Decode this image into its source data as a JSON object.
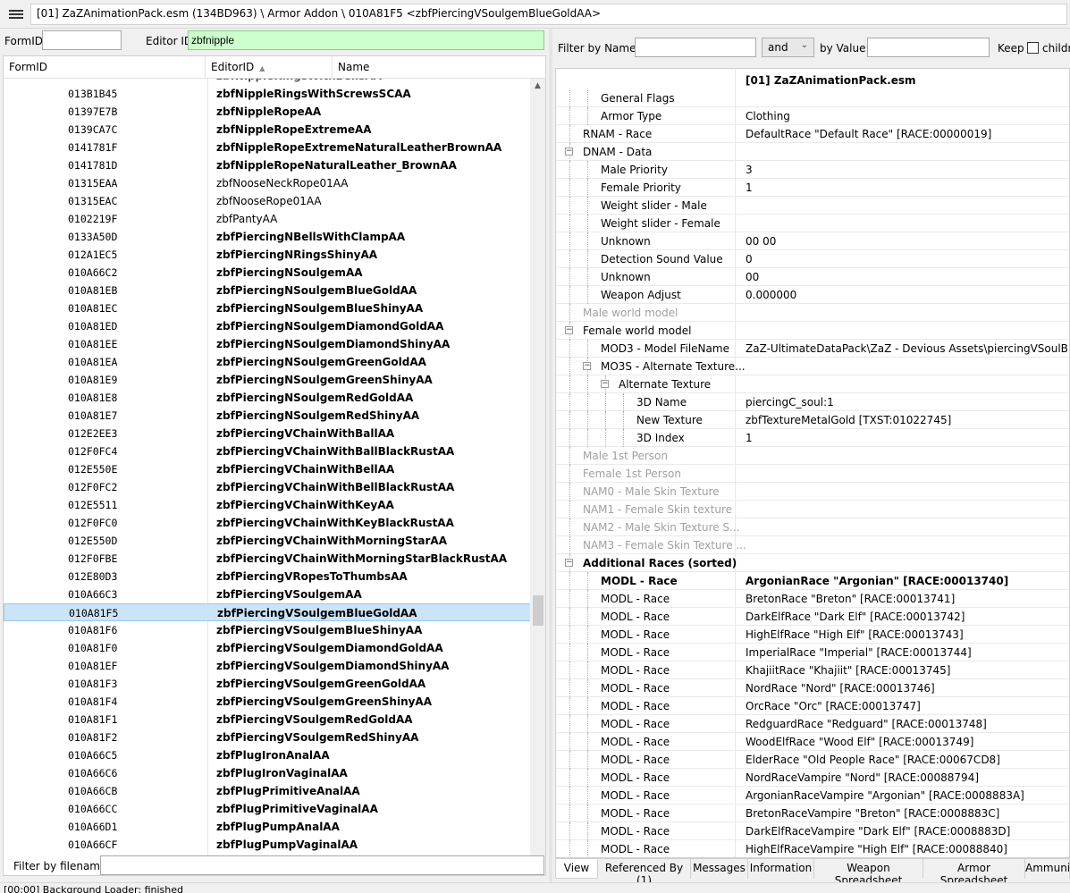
{
  "header": {
    "path": "[01] ZaZAnimationPack.esm (134BD963) \\ Armor Addon \\ 010A81F5 <zbfPiercingVSoulgemBlueGoldAA>"
  },
  "left": {
    "formid_label": "FormID",
    "formid_value": "",
    "editorid_label": "Editor ID",
    "editorid_value": "zbfnipple",
    "columns": [
      "FormID",
      "EditorID",
      "Name"
    ],
    "rows": [
      {
        "fid": "013B1B45",
        "eid": "zbfNippleRingsWithScrewsSCAA",
        "mod": true
      },
      {
        "fid": "01397E7B",
        "eid": "zbfNippleRopeAA",
        "mod": true
      },
      {
        "fid": "0139CA7C",
        "eid": "zbfNippleRopeExtremeAA",
        "mod": true
      },
      {
        "fid": "0141781F",
        "eid": "zbfNippleRopeExtremeNaturalLeatherBrownAA",
        "mod": true
      },
      {
        "fid": "0141781D",
        "eid": "zbfNippleRopeNaturalLeather_BrownAA",
        "mod": true
      },
      {
        "fid": "01315EAA",
        "eid": "zbfNooseNeckRope01AA",
        "mod": false
      },
      {
        "fid": "01315EAC",
        "eid": "zbfNooseRope01AA",
        "mod": false
      },
      {
        "fid": "0102219F",
        "eid": "zbfPantyAA",
        "mod": false
      },
      {
        "fid": "0133A50D",
        "eid": "zbfPiercingNBellsWithClampAA",
        "mod": true
      },
      {
        "fid": "012A1EC5",
        "eid": "zbfPiercingNRingsShinyAA",
        "mod": true
      },
      {
        "fid": "010A66C2",
        "eid": "zbfPiercingNSoulgemAA",
        "mod": true
      },
      {
        "fid": "010A81EB",
        "eid": "zbfPiercingNSoulgemBlueGoldAA",
        "mod": true
      },
      {
        "fid": "010A81EC",
        "eid": "zbfPiercingNSoulgemBlueShinyAA",
        "mod": true
      },
      {
        "fid": "010A81ED",
        "eid": "zbfPiercingNSoulgemDiamondGoldAA",
        "mod": true
      },
      {
        "fid": "010A81EE",
        "eid": "zbfPiercingNSoulgemDiamondShinyAA",
        "mod": true
      },
      {
        "fid": "010A81EA",
        "eid": "zbfPiercingNSoulgemGreenGoldAA",
        "mod": true
      },
      {
        "fid": "010A81E9",
        "eid": "zbfPiercingNSoulgemGreenShinyAA",
        "mod": true
      },
      {
        "fid": "010A81E8",
        "eid": "zbfPiercingNSoulgemRedGoldAA",
        "mod": true
      },
      {
        "fid": "010A81E7",
        "eid": "zbfPiercingNSoulgemRedShinyAA",
        "mod": true
      },
      {
        "fid": "012E2EE3",
        "eid": "zbfPiercingVChainWithBallAA",
        "mod": true
      },
      {
        "fid": "012F0FC4",
        "eid": "zbfPiercingVChainWithBallBlackRustAA",
        "mod": true
      },
      {
        "fid": "012E550E",
        "eid": "zbfPiercingVChainWithBellAA",
        "mod": true
      },
      {
        "fid": "012F0FC2",
        "eid": "zbfPiercingVChainWithBellBlackRustAA",
        "mod": true
      },
      {
        "fid": "012E5511",
        "eid": "zbfPiercingVChainWithKeyAA",
        "mod": true
      },
      {
        "fid": "012F0FC0",
        "eid": "zbfPiercingVChainWithKeyBlackRustAA",
        "mod": true
      },
      {
        "fid": "012E550D",
        "eid": "zbfPiercingVChainWithMorningStarAA",
        "mod": true
      },
      {
        "fid": "012F0FBE",
        "eid": "zbfPiercingVChainWithMorningStarBlackRustAA",
        "mod": true
      },
      {
        "fid": "012E80D3",
        "eid": "zbfPiercingVRopesToThumbsAA",
        "mod": true
      },
      {
        "fid": "010A66C3",
        "eid": "zbfPiercingVSoulgemAA",
        "mod": true
      },
      {
        "fid": "010A81F5",
        "eid": "zbfPiercingVSoulgemBlueGoldAA",
        "mod": true,
        "sel": true
      },
      {
        "fid": "010A81F6",
        "eid": "zbfPiercingVSoulgemBlueShinyAA",
        "mod": true
      },
      {
        "fid": "010A81F0",
        "eid": "zbfPiercingVSoulgemDiamondGoldAA",
        "mod": true
      },
      {
        "fid": "010A81EF",
        "eid": "zbfPiercingVSoulgemDiamondShinyAA",
        "mod": true
      },
      {
        "fid": "010A81F3",
        "eid": "zbfPiercingVSoulgemGreenGoldAA",
        "mod": true
      },
      {
        "fid": "010A81F4",
        "eid": "zbfPiercingVSoulgemGreenShinyAA",
        "mod": true
      },
      {
        "fid": "010A81F1",
        "eid": "zbfPiercingVSoulgemRedGoldAA",
        "mod": true
      },
      {
        "fid": "010A81F2",
        "eid": "zbfPiercingVSoulgemRedShinyAA",
        "mod": true
      },
      {
        "fid": "010A66C5",
        "eid": "zbfPlugIronAnalAA",
        "mod": true
      },
      {
        "fid": "010A66C6",
        "eid": "zbfPlugIronVaginalAA",
        "mod": true
      },
      {
        "fid": "010A66CB",
        "eid": "zbfPlugPrimitiveAnalAA",
        "mod": true
      },
      {
        "fid": "010A66CC",
        "eid": "zbfPlugPrimitiveVaginalAA",
        "mod": true
      },
      {
        "fid": "010A66D1",
        "eid": "zbfPlugPumpAnalAA",
        "mod": true
      },
      {
        "fid": "010A66CF",
        "eid": "zbfPlugPumpVaginalAA",
        "mod": true
      }
    ],
    "filter_label": "Filter by filename:",
    "filter_value": ""
  },
  "right": {
    "filter_name_label": "Filter by Name:",
    "and_value": "and",
    "by_value_label": "by Value:",
    "keep_label": "Keep",
    "children_label": "children",
    "column_header": "[01] ZaZAnimationPack.esm",
    "tree": [
      {
        "n": "General Flags",
        "v": "",
        "lvl": 2
      },
      {
        "n": "Armor Type",
        "v": "Clothing",
        "lvl": 2
      },
      {
        "n": "RNAM - Race",
        "v": "DefaultRace \"Default Race\" [RACE:00000019]",
        "lvl": 1
      },
      {
        "n": "DNAM - Data",
        "v": "",
        "lvl": 1,
        "exp": "−"
      },
      {
        "n": "Male Priority",
        "v": "3",
        "lvl": 2
      },
      {
        "n": "Female Priority",
        "v": "1",
        "lvl": 2
      },
      {
        "n": "Weight slider - Male",
        "v": "",
        "lvl": 2
      },
      {
        "n": "Weight slider - Female",
        "v": "",
        "lvl": 2
      },
      {
        "n": "Unknown",
        "v": "00 00",
        "lvl": 2
      },
      {
        "n": "Detection Sound Value",
        "v": "0",
        "lvl": 2
      },
      {
        "n": "Unknown",
        "v": "00",
        "lvl": 2
      },
      {
        "n": "Weapon Adjust",
        "v": "0.000000",
        "lvl": 2
      },
      {
        "n": "Male world model",
        "v": "",
        "lvl": 1,
        "dis": true
      },
      {
        "n": "Female world model",
        "v": "",
        "lvl": 1,
        "exp": "−"
      },
      {
        "n": "MOD3 - Model FileName",
        "v": "ZaZ-UltimateDataPack\\ZaZ - Devious Assets\\piercingVSoulBlue.nif",
        "lvl": 2
      },
      {
        "n": "MO3S - Alternate Texture...",
        "v": "",
        "lvl": 2,
        "exp": "−"
      },
      {
        "n": "Alternate Texture",
        "v": "",
        "lvl": 3,
        "exp": "−"
      },
      {
        "n": "3D Name",
        "v": "piercingC_soul:1",
        "lvl": 4
      },
      {
        "n": "New Texture",
        "v": "zbfTextureMetalGold [TXST:01022745]",
        "lvl": 4
      },
      {
        "n": "3D Index",
        "v": "1",
        "lvl": 4
      },
      {
        "n": "Male 1st Person",
        "v": "",
        "lvl": 1,
        "dis": true
      },
      {
        "n": "Female 1st Person",
        "v": "",
        "lvl": 1,
        "dis": true
      },
      {
        "n": "NAM0 - Male Skin Texture",
        "v": "",
        "lvl": 1,
        "dis": true
      },
      {
        "n": "NAM1 - Female Skin texture",
        "v": "",
        "lvl": 1,
        "dis": true
      },
      {
        "n": "NAM2 - Male Skin Texture S...",
        "v": "",
        "lvl": 1,
        "dis": true
      },
      {
        "n": "NAM3 - Female Skin Texture ...",
        "v": "",
        "lvl": 1,
        "dis": true
      },
      {
        "n": "Additional Races (sorted)",
        "v": "",
        "lvl": 1,
        "exp": "−",
        "b": true
      },
      {
        "n": "MODL - Race",
        "v": "ArgonianRace \"Argonian\" [RACE:00013740]",
        "lvl": 2,
        "b": true
      },
      {
        "n": "MODL - Race",
        "v": "BretonRace \"Breton\" [RACE:00013741]",
        "lvl": 2
      },
      {
        "n": "MODL - Race",
        "v": "DarkElfRace \"Dark Elf\" [RACE:00013742]",
        "lvl": 2
      },
      {
        "n": "MODL - Race",
        "v": "HighElfRace \"High Elf\" [RACE:00013743]",
        "lvl": 2
      },
      {
        "n": "MODL - Race",
        "v": "ImperialRace \"Imperial\" [RACE:00013744]",
        "lvl": 2
      },
      {
        "n": "MODL - Race",
        "v": "KhajiitRace \"Khajiit\" [RACE:00013745]",
        "lvl": 2
      },
      {
        "n": "MODL - Race",
        "v": "NordRace \"Nord\" [RACE:00013746]",
        "lvl": 2
      },
      {
        "n": "MODL - Race",
        "v": "OrcRace \"Orc\" [RACE:00013747]",
        "lvl": 2
      },
      {
        "n": "MODL - Race",
        "v": "RedguardRace \"Redguard\" [RACE:00013748]",
        "lvl": 2
      },
      {
        "n": "MODL - Race",
        "v": "WoodElfRace \"Wood Elf\" [RACE:00013749]",
        "lvl": 2
      },
      {
        "n": "MODL - Race",
        "v": "ElderRace \"Old People Race\" [RACE:00067CD8]",
        "lvl": 2
      },
      {
        "n": "MODL - Race",
        "v": "NordRaceVampire \"Nord\" [RACE:00088794]",
        "lvl": 2
      },
      {
        "n": "MODL - Race",
        "v": "ArgonianRaceVampire \"Argonian\" [RACE:0008883A]",
        "lvl": 2
      },
      {
        "n": "MODL - Race",
        "v": "BretonRaceVampire \"Breton\" [RACE:0008883C]",
        "lvl": 2
      },
      {
        "n": "MODL - Race",
        "v": "DarkElfRaceVampire \"Dark Elf\" [RACE:0008883D]",
        "lvl": 2
      },
      {
        "n": "MODL - Race",
        "v": "HighElfRaceVampire \"High Elf\" [RACE:00088840]",
        "lvl": 2
      }
    ],
    "tabs": [
      "View",
      "Referenced By (1)",
      "Messages",
      "Information",
      "Weapon Spreadsheet",
      "Armor Spreadsheet",
      "Ammuni"
    ]
  },
  "status": "[00:00] Background Loader: finished",
  "colors": {
    "selected_row": "#cce4f7",
    "editor_id_bg": "#ccffcc"
  }
}
